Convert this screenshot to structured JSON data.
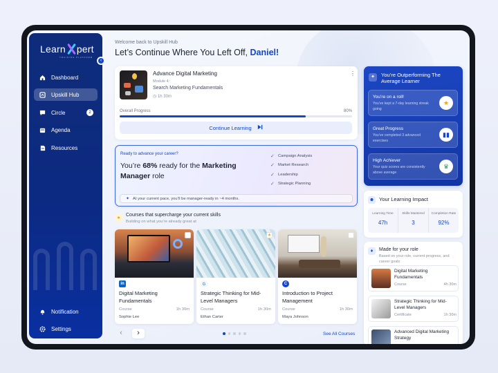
{
  "app": {
    "logo_text_1": "Learn",
    "logo_text_2": "pert",
    "logo_sub": "TRAINING PLATFORM"
  },
  "sidebar": {
    "items": [
      {
        "label": "Dashboard",
        "icon": "home-icon"
      },
      {
        "label": "Upskill Hub",
        "icon": "upskill-icon",
        "active": true
      },
      {
        "label": "Circle",
        "icon": "chat-icon",
        "badge": "2"
      },
      {
        "label": "Agenda",
        "icon": "calendar-icon"
      },
      {
        "label": "Resources",
        "icon": "document-icon"
      }
    ],
    "bottom": [
      {
        "label": "Notification",
        "icon": "bell-icon"
      },
      {
        "label": "Settings",
        "icon": "gear-icon"
      }
    ]
  },
  "header": {
    "welcome": "Welcome back to Upskill Hub",
    "headline_prefix": "Let’s Continue Where You Left Off,",
    "user_name": "Daniel!"
  },
  "current_course": {
    "title": "Advance Digital Marketing",
    "module": "Module 4:",
    "module_title": "Search Marketing Fundamentals",
    "duration": "1h 30m",
    "progress_label": "Overall Progress",
    "progress_text": "80%",
    "progress_value": 0.8,
    "continue_label": "Continue Learning"
  },
  "career": {
    "question": "Ready to advance your career?",
    "line_pre": "You’re",
    "percent": "68%",
    "line_mid": "ready for the",
    "role": "Marketing Manager",
    "line_post": "role",
    "skills": [
      "Campaign Analysis",
      "Market Research",
      "Leadership",
      "Strategic Planning"
    ],
    "note": "At your current pace, you’ll be manager-ready in ~4 months."
  },
  "courses_section": {
    "title": "Courses that supercharge your current skills",
    "subtitle": "Building on what you’re already great at",
    "see_all": "See All Courses",
    "page_count": 5,
    "current_page": 1,
    "items": [
      {
        "title": "Digital Marketing Fundamentals",
        "type": "Course",
        "duration": "1h 30m",
        "author": "Sophie Lee",
        "provider_icon": "linkedin-icon"
      },
      {
        "title": "Strategic Thinking for Mid-Level Managers",
        "type": "Course",
        "duration": "1h 30m",
        "author": "Ethan Carter",
        "provider_icon": "google-icon"
      },
      {
        "title": "Introduction to Project Management",
        "type": "Course",
        "duration": "1h 30m",
        "author": "Maya Johnson",
        "provider_icon": "coursera-icon"
      }
    ]
  },
  "performance": {
    "title": "You’re Outperforming The Average Learner",
    "achievements": [
      {
        "title": "You’re on a roll!",
        "desc": "You’ve kept a 7-day learning streak going",
        "icon": "star-icon"
      },
      {
        "title": "Great Progress",
        "desc": "You’ve completed 3 advanced exercises",
        "icon": "book-icon"
      },
      {
        "title": "High Achiever",
        "desc": "Your quiz scores are consistently above average",
        "icon": "trophy-icon"
      }
    ]
  },
  "impact": {
    "title": "Your Learning Impact",
    "stats": [
      {
        "label": "Learning Time",
        "value": "47h"
      },
      {
        "label": "Skills Mastered",
        "value": "3"
      },
      {
        "label": "Completion Rate",
        "value": "92%"
      }
    ]
  },
  "made_for_role": {
    "title": "Made for your role",
    "subtitle": "Based on your role, current progress, and career goals",
    "items": [
      {
        "title": "Digital Marketing Fundamentals",
        "type": "Course",
        "duration": "4h 30m"
      },
      {
        "title": "Strategic Thinking for Mid-Level Managers",
        "type": "Certificate",
        "duration": "1h 30m"
      },
      {
        "title": "Advanced Digital Marketing Strategy",
        "type": "",
        "duration": ""
      }
    ]
  },
  "colors": {
    "accent": "#1446c8",
    "sidebar": "#0f2c7a",
    "background": "#eef2fb"
  }
}
